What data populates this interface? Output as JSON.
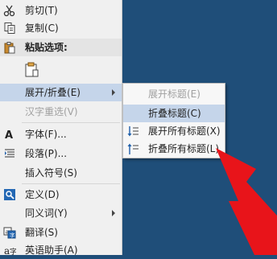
{
  "context_menu": {
    "items": [
      {
        "label": "剪切(T)",
        "icon": "scissors-icon"
      },
      {
        "label": "复制(C)",
        "icon": "copy-icon"
      },
      {
        "label": "粘贴选项:",
        "icon": "paste-icon"
      },
      {
        "label": "",
        "icon": "paste-keep-text-icon"
      },
      {
        "label": "展开/折叠(E)",
        "icon": ""
      },
      {
        "label": "汉字重选(V)",
        "icon": ""
      },
      {
        "label": "字体(F)...",
        "icon": "font-icon"
      },
      {
        "label": "段落(P)...",
        "icon": "paragraph-icon"
      },
      {
        "label": "插入符号(S)",
        "icon": ""
      },
      {
        "label": "定义(D)",
        "icon": "define-icon"
      },
      {
        "label": "同义词(Y)",
        "icon": ""
      },
      {
        "label": "翻译(S)",
        "icon": "translate-icon"
      },
      {
        "label": "英语助手(A)",
        "icon": "english-assistant-icon"
      }
    ]
  },
  "submenu": {
    "items": [
      {
        "label": "展开标题(E)",
        "icon": ""
      },
      {
        "label": "折叠标题(C)",
        "icon": ""
      },
      {
        "label": "展开所有标题(X)",
        "icon": "expand-all-icon"
      },
      {
        "label": "折叠所有标题(L)",
        "icon": "collapse-all-icon"
      }
    ]
  },
  "colors": {
    "background": "#1f4e79",
    "menu_bg": "#f0f0f0",
    "highlight": "#c5d5ea",
    "disabled_text": "#a0a0a0",
    "arrow": "#e8141a"
  }
}
